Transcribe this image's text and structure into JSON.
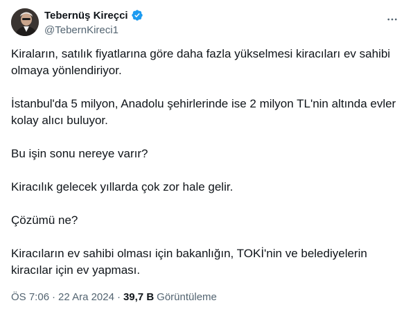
{
  "author": {
    "display_name": "Tebernüş Kireçci",
    "handle": "@TebernKireci1"
  },
  "tweet": {
    "paragraphs": [
      "Kiraların, satılık fiyatlarına göre daha fazla yükselmesi kiracıları ev sahibi olmaya yönlendiriyor.",
      "İstanbul'da 5 milyon, Anadolu şehirlerinde ise 2 milyon TL'nin altında evler kolay alıcı buluyor.",
      "Bu işin sonu nereye varır?",
      "Kiracılık gelecek yıllarda çok zor hale gelir.",
      "Çözümü ne?",
      "Kiracıların ev sahibi olması için bakanlığın, TOKİ'nin ve belediyelerin kiracılar için ev yapması."
    ]
  },
  "meta": {
    "time": "ÖS 7:06",
    "separator": "·",
    "date": "22 Ara 2024",
    "views_count": "39,7 B",
    "views_label": "Görüntüleme"
  },
  "icons": {
    "verified": "verified-badge-icon",
    "more": "more-options-icon"
  },
  "colors": {
    "verified_blue": "#1d9bf0",
    "secondary_text": "#536471",
    "primary_text": "#0f1419"
  }
}
